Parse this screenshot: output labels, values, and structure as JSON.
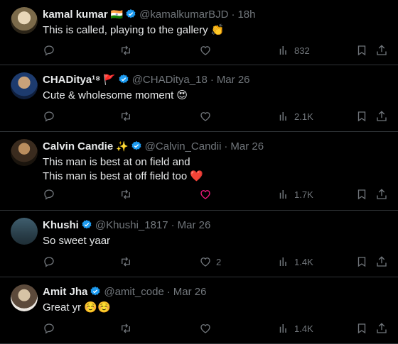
{
  "tweets": [
    {
      "name": "kamal kumar",
      "name_emoji": "🇮🇳",
      "handle": "@kamalkumarBJD",
      "time": "18h",
      "text": "This is called, playing to the gallery 👏",
      "replies": "",
      "retweets": "",
      "likes": "",
      "views": "832"
    },
    {
      "name": "CHADitya¹⁸",
      "name_emoji": "🚩",
      "handle": "@CHADitya_18",
      "time": "Mar 26",
      "text": "Cute & wholesome moment 😍",
      "replies": "",
      "retweets": "",
      "likes": "",
      "views": "2.1K"
    },
    {
      "name": "Calvin Candie",
      "name_emoji": "✨",
      "handle": "@Calvin_Candii",
      "time": "Mar 26",
      "text": "This man is best at on field and\nThis man is best at off field too ❤️",
      "replies": "",
      "retweets": "",
      "likes": "",
      "views": "1.7K"
    },
    {
      "name": "Khushi",
      "name_emoji": "",
      "handle": "@Khushi_1817",
      "time": "Mar 26",
      "text": "So sweet yaar",
      "replies": "",
      "retweets": "",
      "likes": "2",
      "views": "1.4K"
    },
    {
      "name": "Amit Jha",
      "name_emoji": "",
      "handle": "@amit_code",
      "time": "Mar 26",
      "text": "Great yr ☺️☺️",
      "replies": "",
      "retweets": "",
      "likes": "",
      "views": "1.4K"
    }
  ],
  "icons": {
    "verified": "verified-badge-icon",
    "reply": "reply-icon",
    "retweet": "retweet-icon",
    "like": "heart-icon",
    "views": "views-chart-icon",
    "bookmark": "bookmark-icon",
    "share": "share-icon"
  },
  "colors": {
    "background": "#000000",
    "text": "#e7e9ea",
    "muted": "#71767b",
    "verified": "#1d9bf0",
    "like_active": "#f91880",
    "divider": "#2f3336"
  }
}
